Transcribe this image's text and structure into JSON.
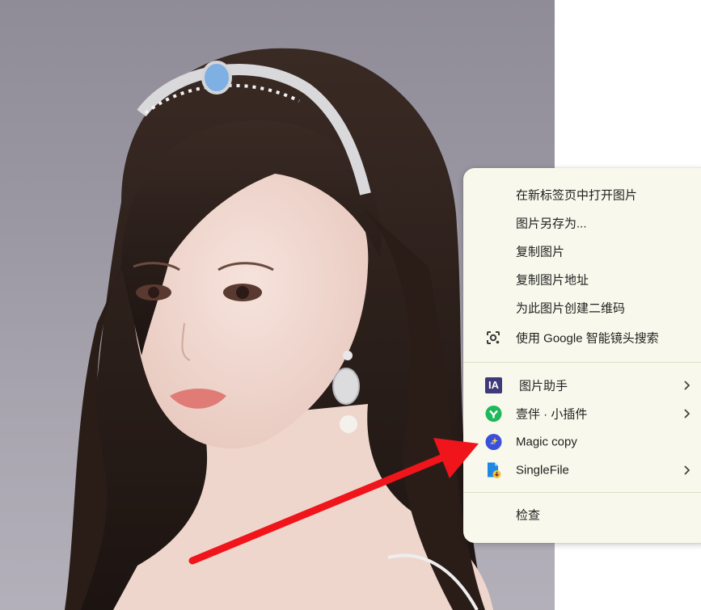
{
  "context_menu": {
    "items_group1": [
      {
        "label": "在新标签页中打开图片"
      },
      {
        "label": "图片另存为..."
      },
      {
        "label": "复制图片"
      },
      {
        "label": "复制图片地址"
      },
      {
        "label": "为此图片创建二维码"
      },
      {
        "label": "使用 Google 智能镜头搜索",
        "icon": "google-lens-icon"
      }
    ],
    "items_group2": [
      {
        "label": "图片助手",
        "icon": "image-assistant-icon",
        "icon_text": "IA",
        "submenu": true
      },
      {
        "label": "壹伴 · 小插件",
        "icon": "yiban-icon",
        "submenu": true
      },
      {
        "label": "Magic copy",
        "icon": "magic-copy-icon",
        "submenu": false
      },
      {
        "label": "SingleFile",
        "icon": "singlefile-icon",
        "submenu": true
      }
    ],
    "items_group3": [
      {
        "label": "检查"
      }
    ]
  },
  "colors": {
    "menu_background": "#f8f9ec",
    "separator": "#dbe0c8",
    "annotation_arrow": "#f0141b",
    "photo_background": "#9a97a2"
  }
}
